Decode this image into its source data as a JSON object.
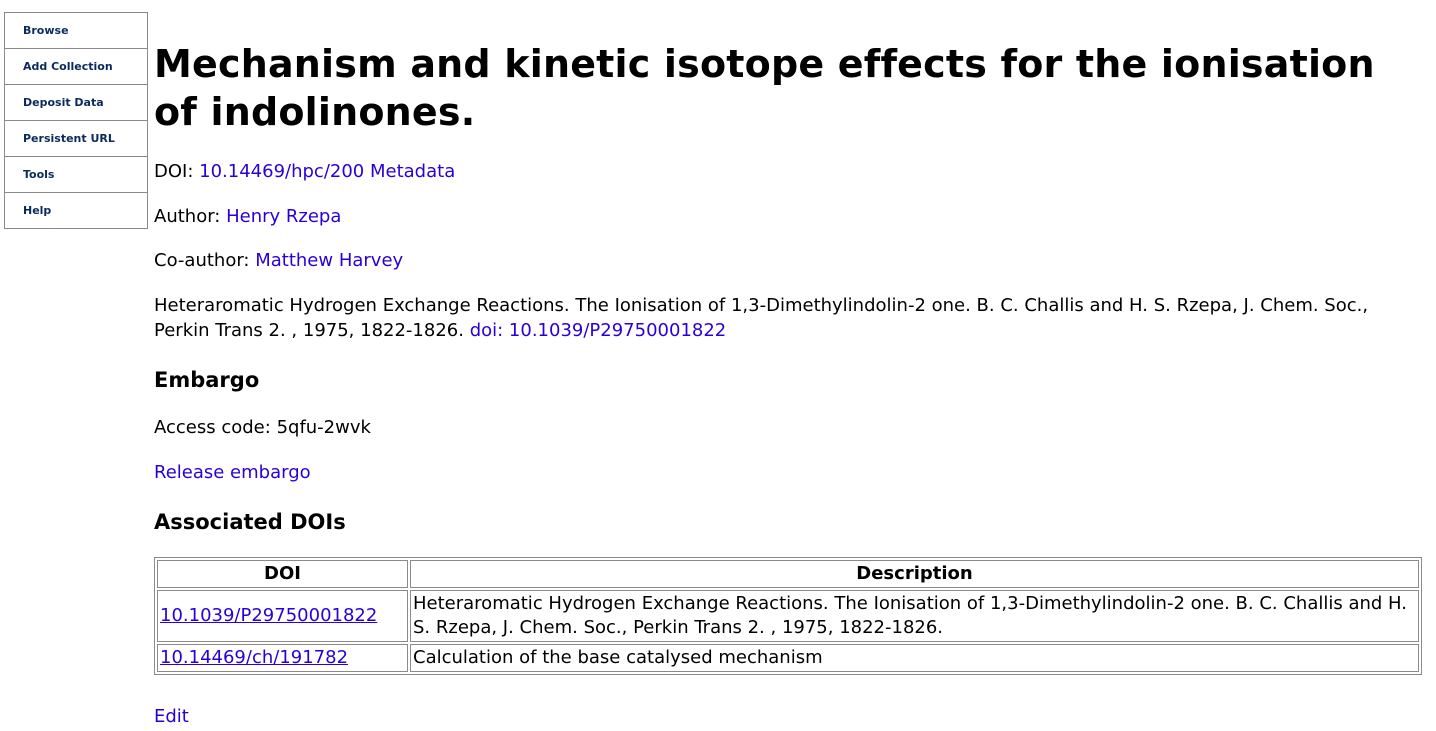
{
  "sidebar": {
    "items": [
      {
        "label": "Browse"
      },
      {
        "label": "Add Collection"
      },
      {
        "label": "Deposit Data"
      },
      {
        "label": "Persistent URL"
      },
      {
        "label": "Tools"
      },
      {
        "label": "Help"
      }
    ]
  },
  "page": {
    "title": "Mechanism and kinetic isotope effects for the ionisation of indolinones."
  },
  "doi": {
    "label": "DOI:",
    "value": "10.14469/hpc/200",
    "metadata_link": "Metadata"
  },
  "author": {
    "label": "Author:",
    "name": "Henry Rzepa"
  },
  "coauthor": {
    "label": "Co-author:",
    "name": "Matthew Harvey"
  },
  "citation": {
    "text": "Heteraromatic Hydrogen Exchange Reactions. The Ionisation of 1,3-Dimethylindolin-2 one. B. C. Challis and H. S. Rzepa, J. Chem. Soc., Perkin Trans 2. , 1975, 1822-1826.",
    "doi_link": "doi: 10.1039/P29750001822"
  },
  "embargo": {
    "heading": "Embargo",
    "access_label": "Access code:",
    "access_code": "5qfu-2wvk",
    "release_link": "Release embargo"
  },
  "associated": {
    "heading": "Associated DOIs",
    "columns": [
      "DOI",
      "Description"
    ],
    "rows": [
      {
        "doi": "10.1039/P29750001822",
        "description": "Heteraromatic Hydrogen Exchange Reactions. The Ionisation of 1,3-Dimethylindolin-2 one. B. C. Challis and H. S. Rzepa, J. Chem. Soc., Perkin Trans 2. , 1975, 1822-1826."
      },
      {
        "doi": "10.14469/ch/191782",
        "description": "Calculation of the base catalysed mechanism"
      }
    ]
  },
  "footer": {
    "edit_link": "Edit"
  },
  "colors": {
    "link": "#2a00d8",
    "nav_text": "#0b2a5c",
    "border": "#8a8a8a"
  }
}
